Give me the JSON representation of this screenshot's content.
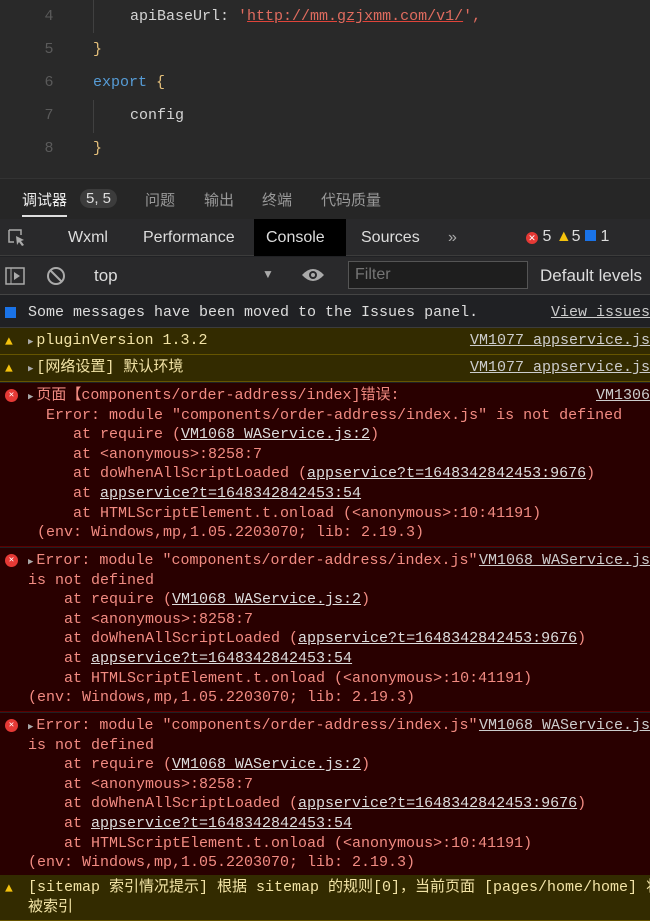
{
  "editor": {
    "lines": [
      {
        "num": "4",
        "indent": 2,
        "parts": [
          {
            "t": "apiBaseUrl: ",
            "c": "prop"
          },
          {
            "t": "'",
            "c": "str"
          },
          {
            "t": "http://mm.gzjxmm.com/v1/",
            "c": "url"
          },
          {
            "t": "',",
            "c": "str"
          }
        ]
      },
      {
        "num": "5",
        "indent": 1,
        "parts": [
          {
            "t": "}",
            "c": "br"
          }
        ]
      },
      {
        "num": "6",
        "indent": 1,
        "parts": [
          {
            "t": "export ",
            "c": "kw"
          },
          {
            "t": "{",
            "c": "br"
          }
        ]
      },
      {
        "num": "7",
        "indent": 2,
        "parts": [
          {
            "t": "config",
            "c": "prop"
          }
        ]
      },
      {
        "num": "8",
        "indent": 1,
        "parts": [
          {
            "t": "}",
            "c": "br"
          }
        ]
      }
    ]
  },
  "panel_tabs": {
    "items": [
      "调试器",
      "问题",
      "输出",
      "终端",
      "代码质量"
    ],
    "badge": "5, 5"
  },
  "devtools_tabs": {
    "items": [
      "Wxml",
      "Performance",
      "Console",
      "Sources"
    ],
    "active": "Console",
    "more": "»",
    "counts": {
      "errors": "5",
      "warnings": "5",
      "info": "1"
    }
  },
  "toolbar": {
    "context": "top",
    "filter_placeholder": "Filter",
    "levels": "Default levels"
  },
  "colors": {
    "error_bg": "#290000",
    "warn_bg": "#332b00",
    "active_tab": "#000000"
  },
  "console": [
    {
      "type": "info",
      "lines": [
        "Some messages have been moved to the Issues panel."
      ],
      "src": "View issues"
    },
    {
      "type": "warn",
      "expand": true,
      "lines": [
        "pluginVersion 1.3.2"
      ],
      "src": "VM1077 appservice.js"
    },
    {
      "type": "warn",
      "expand": true,
      "lines": [
        "[网络设置] 默认环境"
      ],
      "src": "VM1077 appservice.js"
    },
    {
      "type": "err",
      "expand": true,
      "lines": [
        "页面【components/order-address/index]错误:",
        " Error: module \"components/order-address/index.js\" is not defined",
        "    at require (|VM1068 WAService.js:2|)",
        "    at <anonymous>:8258:7",
        "    at doWhenAllScriptLoaded (|appservice?t=1648342842453:9676|)",
        "    at |appservice?t=1648342842453:54|",
        "    at HTMLScriptElement.t.onload (<anonymous>:10:41191)",
        "(env: Windows,mp,1.05.2203070; lib: 2.19.3)"
      ],
      "src": "VM1306"
    },
    {
      "type": "err",
      "expand": true,
      "lines": [
        "Error: module \"components/order-address/index.js\"",
        "is not defined",
        "    at require (|VM1068 WAService.js:2|)",
        "    at <anonymous>:8258:7",
        "    at doWhenAllScriptLoaded (|appservice?t=1648342842453:9676|)",
        "    at |appservice?t=1648342842453:54|",
        "    at HTMLScriptElement.t.onload (<anonymous>:10:41191)",
        "(env: Windows,mp,1.05.2203070; lib: 2.19.3)"
      ],
      "src": "VM1068 WAService.js"
    },
    {
      "type": "err",
      "expand": true,
      "lines": [
        "Error: module \"components/order-address/index.js\"",
        "is not defined",
        "    at require (|VM1068 WAService.js:2|)",
        "    at <anonymous>:8258:7",
        "    at doWhenAllScriptLoaded (|appservice?t=1648342842453:9676|)",
        "    at |appservice?t=1648342842453:54|",
        "    at HTMLScriptElement.t.onload (<anonymous>:10:41191)",
        "(env: Windows,mp,1.05.2203070; lib: 2.19.3)"
      ],
      "src": "VM1068 WAService.js"
    },
    {
      "type": "warn",
      "lines": [
        "[sitemap 索引情况提示] 根据 sitemap 的规则[0]，当前页面 [pages/home/home] 将",
        "被索引"
      ]
    }
  ]
}
